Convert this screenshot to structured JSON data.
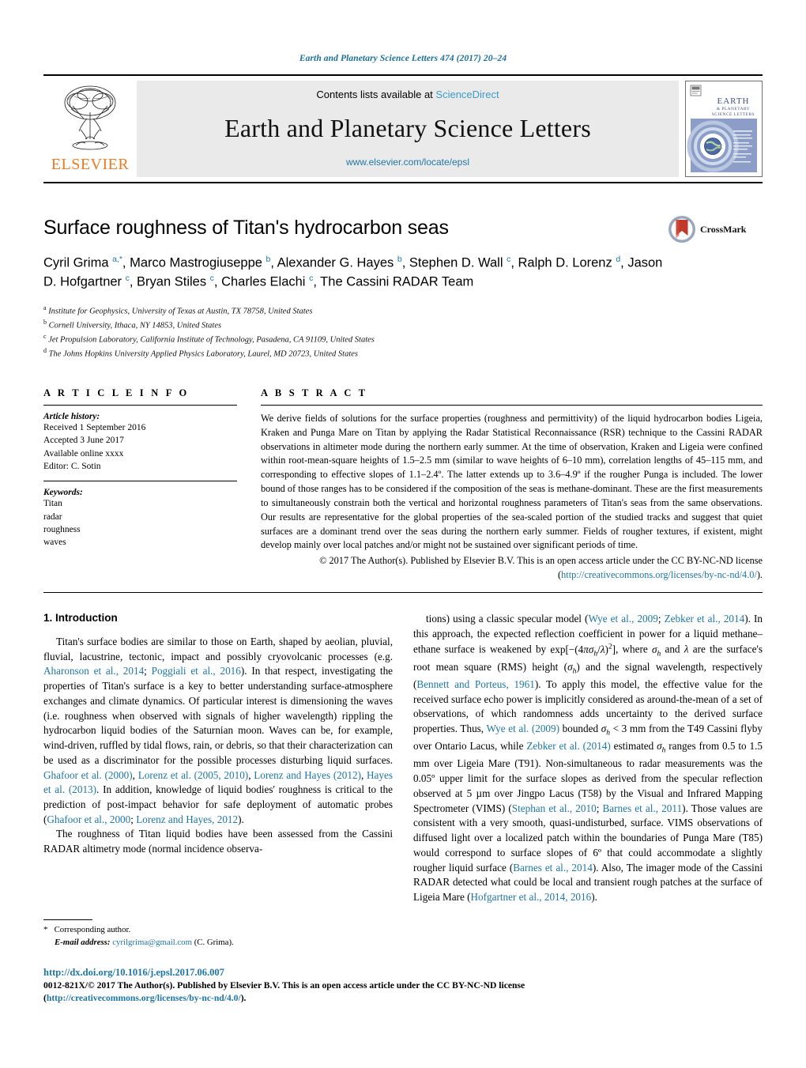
{
  "running_head": "Earth and Planetary Science Letters 474 (2017) 20–24",
  "masthead": {
    "contents_prefix": "Contents lists available at ",
    "sciencedirect": "ScienceDirect",
    "journal_title": "Earth and Planetary Science Letters",
    "journal_url": "www.elsevier.com/locate/epsl",
    "publisher_name": "ELSEVIER",
    "cover_title_line1": "EARTH",
    "cover_title_line2": "& PLANETARY",
    "cover_title_line3": "SCIENCE LETTERS"
  },
  "article": {
    "title": "Surface roughness of Titan's hydrocarbon seas",
    "authors_html": "Cyril Grima <sup>a,*</sup>, Marco Mastrogiuseppe <sup>b</sup>, Alexander G. Hayes <sup>b</sup>, Stephen D. Wall <sup>c</sup>, Ralph D. Lorenz <sup>d</sup>, Jason D. Hofgartner <sup>c</sup>, Bryan Stiles <sup>c</sup>, Charles Elachi <sup>c</sup>, The Cassini RADAR Team",
    "affiliations": [
      {
        "marker": "a",
        "text": "Institute for Geophysics, University of Texas at Austin, TX 78758, United States"
      },
      {
        "marker": "b",
        "text": "Cornell University, Ithaca, NY 14853, United States"
      },
      {
        "marker": "c",
        "text": "Jet Propulsion Laboratory, California Institute of Technology, Pasadena, CA 91109, United States"
      },
      {
        "marker": "d",
        "text": "The Johns Hopkins University Applied Physics Laboratory, Laurel, MD 20723, United States"
      }
    ],
    "crossmark_label": "CrossMark"
  },
  "article_info": {
    "heading": "A R T I C L E    I N F O",
    "history_label": "Article history:",
    "history": [
      "Received 1 September 2016",
      "Accepted 3 June 2017",
      "Available online xxxx",
      "Editor: C. Sotin"
    ],
    "keywords_label": "Keywords:",
    "keywords": [
      "Titan",
      "radar",
      "roughness",
      "waves"
    ]
  },
  "abstract": {
    "heading": "A B S T R A C T",
    "text": "We derive fields of solutions for the surface properties (roughness and permittivity) of the liquid hydrocarbon bodies Ligeia, Kraken and Punga Mare on Titan by applying the Radar Statistical Reconnaissance (RSR) technique to the Cassini RADAR observations in altimeter mode during the northern early summer. At the time of observation, Kraken and Ligeia were confined within root-mean-square heights of 1.5–2.5 mm (similar to wave heights of 6–10 mm), correlation lengths of 45–115 mm, and corresponding to effective slopes of 1.1–2.4º. The latter extends up to 3.6–4.9º if the rougher Punga is included. The lower bound of those ranges has to be considered if the composition of the seas is methane-dominant. These are the first measurements to simultaneously constrain both the vertical and horizontal roughness parameters of Titan's seas from the same observations. Our results are representative for the global properties of the sea-scaled portion of the studied tracks and suggest that quiet surfaces are a dominant trend over the seas during the northern early summer. Fields of rougher textures, if existent, might develop mainly over local patches and/or might not be sustained over significant periods of time.",
    "copyright_prefix": "© 2017 The Author(s). Published by Elsevier B.V. This is an open access article under the CC BY-NC-ND license (",
    "copyright_link": "http://creativecommons.org/licenses/by-nc-nd/4.0/",
    "copyright_suffix": ")."
  },
  "body": {
    "section_title": "1. Introduction",
    "left_paragraphs": [
      {
        "parts": [
          {
            "t": "Titan's surface bodies are similar to those on Earth, shaped by aeolian, pluvial, fluvial, lacustrine, tectonic, impact and possibly cryovolcanic processes (e.g. ",
            "k": "text"
          },
          {
            "t": "Aharonson et al., 2014",
            "k": "ref"
          },
          {
            "t": "; ",
            "k": "text"
          },
          {
            "t": "Poggiali et al., 2016",
            "k": "ref"
          },
          {
            "t": "). In that respect, investigating the properties of Titan's surface is a key to better understanding surface-atmosphere exchanges and climate dynamics. Of particular interest is dimensioning the waves (i.e. roughness when observed with signals of higher wavelength) rippling the hydrocarbon liquid bodies of the Saturnian moon. Waves can be, for example, wind-driven, ruffled by tidal flows, rain, or debris, so that their characterization can be used as a discriminator for the possible processes disturbing liquid surfaces. ",
            "k": "text"
          },
          {
            "t": "Ghafoor et al. (2000)",
            "k": "ref"
          },
          {
            "t": ", ",
            "k": "text"
          },
          {
            "t": "Lorenz et al. (2005, 2010)",
            "k": "ref"
          },
          {
            "t": ", ",
            "k": "text"
          },
          {
            "t": "Lorenz and Hayes (2012)",
            "k": "ref"
          },
          {
            "t": ", ",
            "k": "text"
          },
          {
            "t": "Hayes et al. (2013)",
            "k": "ref"
          },
          {
            "t": ". In addition, knowledge of liquid bodies' roughness is critical to the prediction of post-impact behavior for safe deployment of automatic probes (",
            "k": "text"
          },
          {
            "t": "Ghafoor et al., 2000",
            "k": "ref"
          },
          {
            "t": "; ",
            "k": "text"
          },
          {
            "t": "Lorenz and Hayes, 2012",
            "k": "ref"
          },
          {
            "t": ").",
            "k": "text"
          }
        ]
      },
      {
        "parts": [
          {
            "t": "The roughness of Titan liquid bodies have been assessed from the Cassini RADAR altimetry mode (normal incidence observa-",
            "k": "text"
          }
        ]
      }
    ],
    "right_paragraphs": [
      {
        "parts": [
          {
            "t": "tions) using a classic specular model (",
            "k": "text"
          },
          {
            "t": "Wye et al., 2009",
            "k": "ref"
          },
          {
            "t": "; ",
            "k": "text"
          },
          {
            "t": "Zebker et al., 2014",
            "k": "ref"
          },
          {
            "t": "). In this approach, the expected reflection coefficient in power for a liquid methane–ethane surface is weakened by ",
            "k": "text"
          },
          {
            "t": "EQ1",
            "k": "eq"
          },
          {
            "t": ", where ",
            "k": "text"
          },
          {
            "t": "SIGMAH",
            "k": "eq"
          },
          {
            "t": " and ",
            "k": "text"
          },
          {
            "t": "LAMBDA",
            "k": "eq"
          },
          {
            "t": " are the surface's root mean square (RMS) height (",
            "k": "text"
          },
          {
            "t": "SIGMAH",
            "k": "eq"
          },
          {
            "t": ") and the signal wavelength, respectively (",
            "k": "text"
          },
          {
            "t": "Bennett and Porteus, 1961",
            "k": "ref"
          },
          {
            "t": "). To apply this model, the effective value for the received surface echo power is implicitly considered as around-the-mean of a set of observations, of which randomness adds uncertainty to the derived surface properties. Thus, ",
            "k": "text"
          },
          {
            "t": "Wye et al. (2009)",
            "k": "ref"
          },
          {
            "t": " bounded ",
            "k": "text"
          },
          {
            "t": "SIGMAH",
            "k": "eq"
          },
          {
            "t": " < 3 mm from the T49 Cassini flyby over Ontario Lacus, while ",
            "k": "text"
          },
          {
            "t": "Zebker et al. (2014)",
            "k": "ref"
          },
          {
            "t": " estimated ",
            "k": "text"
          },
          {
            "t": "SIGMAH",
            "k": "eq"
          },
          {
            "t": " ranges from 0.5 to 1.5 mm over Ligeia Mare (T91). Non-simultaneous to radar measurements was the 0.05º upper limit for the surface slopes as derived from the specular reflection observed at 5 µm over Jingpo Lacus (T58) by the Visual and Infrared Mapping Spectrometer (VIMS) (",
            "k": "text"
          },
          {
            "t": "Stephan et al., 2010",
            "k": "ref"
          },
          {
            "t": "; ",
            "k": "text"
          },
          {
            "t": "Barnes et al., 2011",
            "k": "ref"
          },
          {
            "t": "). Those values are consistent with a very smooth, quasi-undisturbed, surface. VIMS observations of diffused light over a localized patch within the boundaries of Punga Mare (T85) would correspond to surface slopes of 6º that could accommodate a slightly rougher liquid surface (",
            "k": "text"
          },
          {
            "t": "Barnes et al., 2014",
            "k": "ref"
          },
          {
            "t": "). Also, The imager mode of the Cassini RADAR detected what could be local and transient rough patches at the surface of Ligeia Mare (",
            "k": "text"
          },
          {
            "t": "Hofgartner et al., 2014, 2016",
            "k": "ref"
          },
          {
            "t": ").",
            "k": "text"
          }
        ]
      }
    ]
  },
  "footnote": {
    "star": "*",
    "corresponding": "Corresponding author.",
    "email_label": "E-mail address:",
    "email": "cyrilgrima@gmail.com",
    "email_suffix": "(C. Grima)."
  },
  "footer": {
    "doi": "http://dx.doi.org/10.1016/j.epsl.2017.06.007",
    "issn_prefix": "0012-821X/© 2017 The Author(s). Published by Elsevier B.V. This is an open access article under the CC BY-NC-ND license",
    "license_open": "(",
    "license_url": "http://creativecommons.org/licenses/by-nc-nd/4.0/",
    "license_close": ")."
  },
  "colors": {
    "link": "#1f77a8",
    "sciencedirect": "#3a9ccb",
    "elsevier_orange": "#ee7a23",
    "masthead_bg": "#eaeaea",
    "crossmark_red": "#c0392b"
  }
}
